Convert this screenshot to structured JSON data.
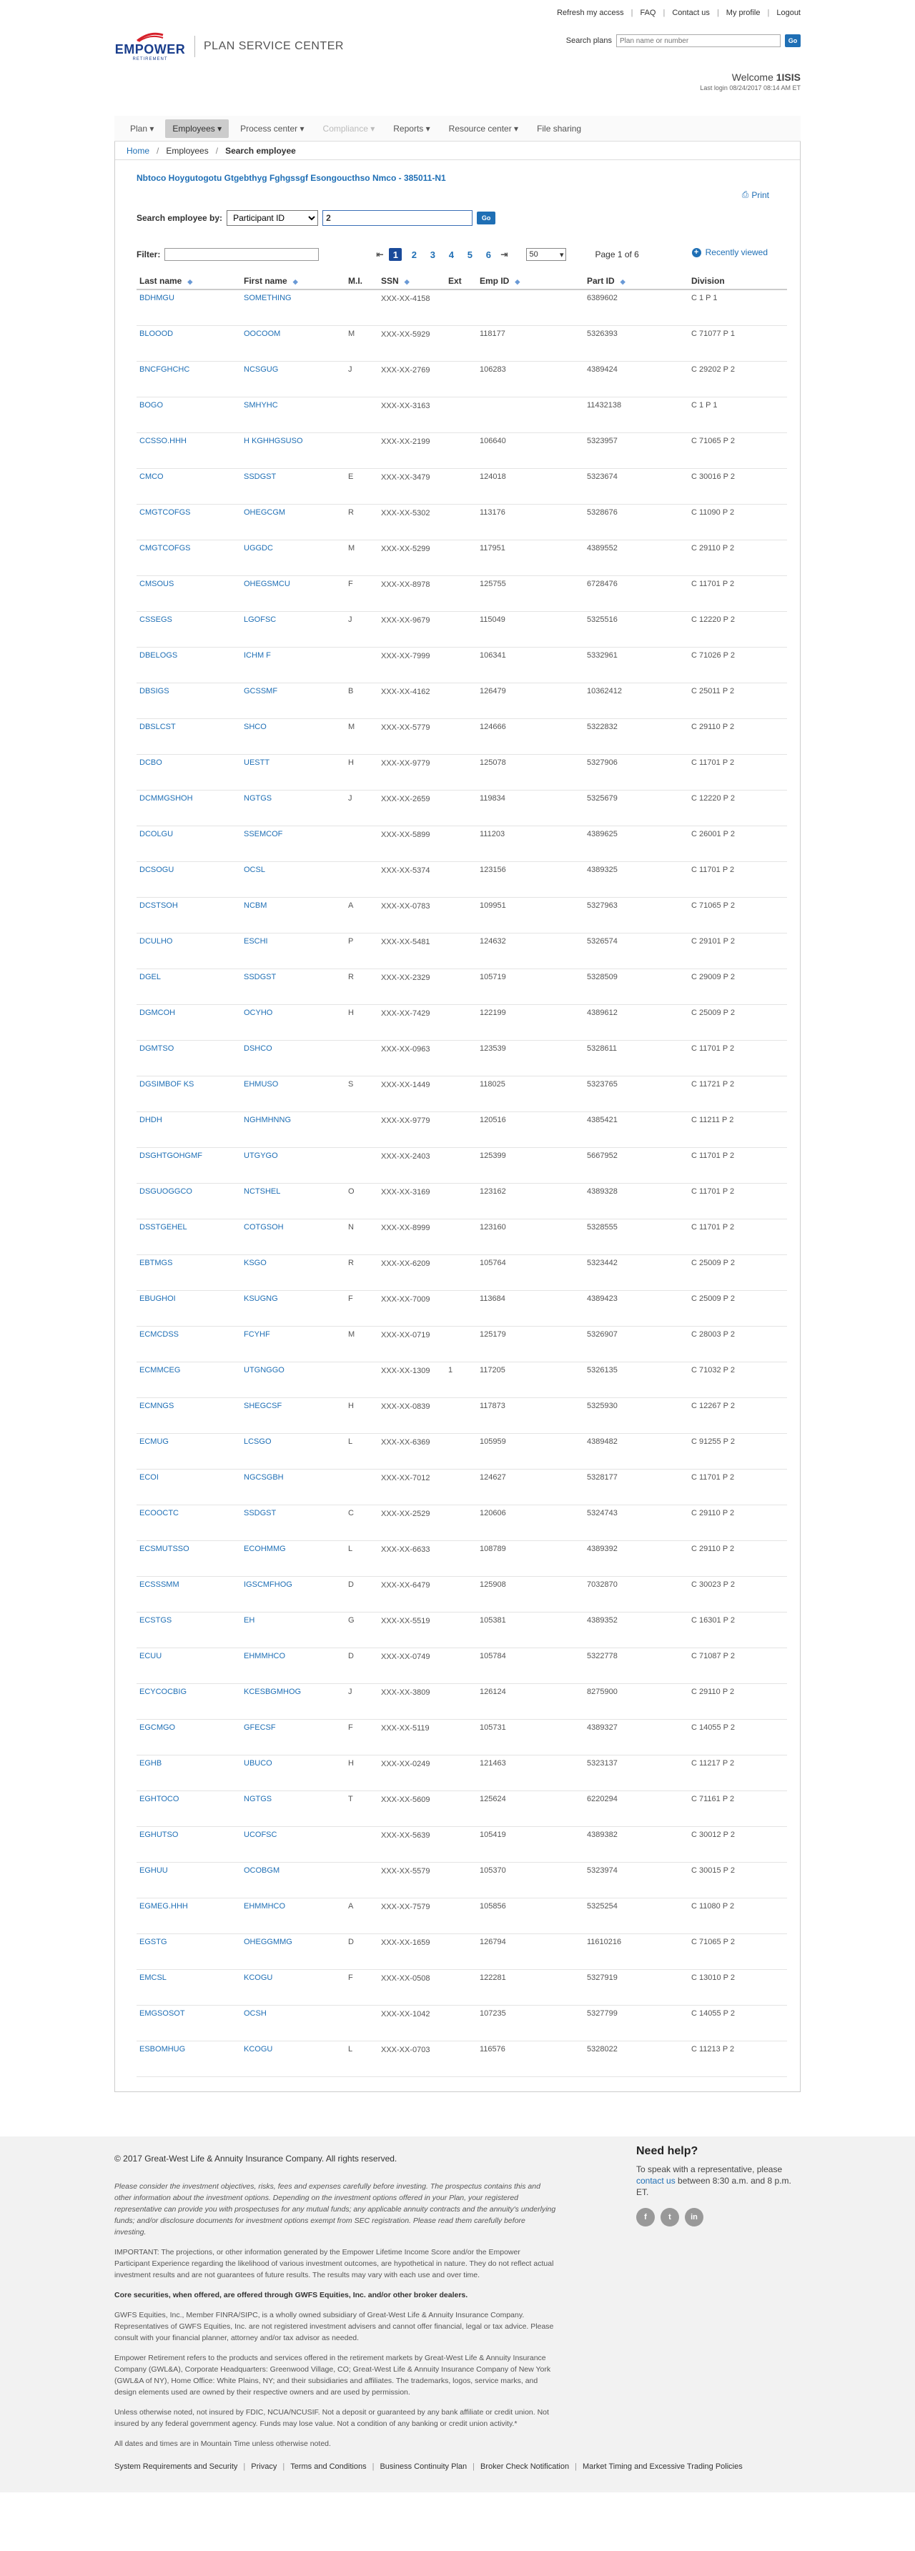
{
  "utility_links": [
    "Refresh my access",
    "FAQ",
    "Contact us",
    "My profile",
    "Logout"
  ],
  "brand": {
    "logo_text": "EMPOWER",
    "logo_sub": "RETIREMENT",
    "title": "PLAN SERVICE CENTER"
  },
  "plan_search": {
    "label": "Search plans",
    "placeholder": "Plan name or number",
    "go": "Go"
  },
  "welcome": {
    "label": "Welcome",
    "user": "1ISIS",
    "last_login": "Last login 08/24/2017 08:14 AM ET"
  },
  "nav": {
    "items": [
      "Plan",
      "Employees",
      "Process center",
      "Compliance",
      "Reports",
      "Resource center",
      "File sharing"
    ]
  },
  "breadcrumb": {
    "home": "Home",
    "employees": "Employees",
    "current": "Search employee"
  },
  "print_label": "Print",
  "plan_name": "Nbtoco Hoygutogotu Gtgebthyg Fghgssgf Esongoucthso Nmco - 385011-N1",
  "search_by": {
    "label": "Search employee by:",
    "field": "Participant ID",
    "value": "2",
    "go": "Go"
  },
  "recently_viewed": "Recently viewed",
  "filter_label": "Filter:",
  "pager": {
    "pages": [
      "1",
      "2",
      "3",
      "4",
      "5",
      "6"
    ],
    "current": "1",
    "page_size": "50",
    "page_of": "Page 1 of 6"
  },
  "table": {
    "headers": [
      "Last name",
      "First name",
      "M.I.",
      "SSN",
      "Ext",
      "Emp ID",
      "Part ID",
      "Division"
    ],
    "rows": [
      [
        "BDHMGU",
        "SOMETHING",
        "",
        "XXX-XX-4158",
        "",
        "",
        "6389602",
        "C 1 P 1"
      ],
      [
        "BLOOOD",
        "OOCOOM",
        "M",
        "XXX-XX-5929",
        "",
        "118177",
        "5326393",
        "C 71077 P 1"
      ],
      [
        "BNCFGHCHC",
        "NCSGUG",
        "J",
        "XXX-XX-2769",
        "",
        "106283",
        "4389424",
        "C 29202 P 2"
      ],
      [
        "BOGO",
        "SMHYHC",
        "",
        "XXX-XX-3163",
        "",
        "",
        "11432138",
        "C 1 P 1"
      ],
      [
        "CCSSO.HHH",
        "H KGHHGSUSO",
        "",
        "XXX-XX-2199",
        "",
        "106640",
        "5323957",
        "C 71065 P 2"
      ],
      [
        "CMCO",
        "SSDGST",
        "E",
        "XXX-XX-3479",
        "",
        "124018",
        "5323674",
        "C 30016 P 2"
      ],
      [
        "CMGTCOFGS",
        "OHEGCGM",
        "R",
        "XXX-XX-5302",
        "",
        "113176",
        "5328676",
        "C 11090 P 2"
      ],
      [
        "CMGTCOFGS",
        "UGGDC",
        "M",
        "XXX-XX-5299",
        "",
        "117951",
        "4389552",
        "C 29110 P 2"
      ],
      [
        "CMSOUS",
        "OHEGSMCU",
        "F",
        "XXX-XX-8978",
        "",
        "125755",
        "6728476",
        "C 11701 P 2"
      ],
      [
        "CSSEGS",
        "LGOFSC",
        "J",
        "XXX-XX-9679",
        "",
        "115049",
        "5325516",
        "C 12220 P 2"
      ],
      [
        "DBELOGS",
        "ICHM F",
        "",
        "XXX-XX-7999",
        "",
        "106341",
        "5332961",
        "C 71026 P 2"
      ],
      [
        "DBSIGS",
        "GCSSMF",
        "B",
        "XXX-XX-4162",
        "",
        "126479",
        "10362412",
        "C 25011 P 2"
      ],
      [
        "DBSLCST",
        "SHCO",
        "M",
        "XXX-XX-5779",
        "",
        "124666",
        "5322832",
        "C 29110 P 2"
      ],
      [
        "DCBO",
        "UESTT",
        "H",
        "XXX-XX-9779",
        "",
        "125078",
        "5327906",
        "C 11701 P 2"
      ],
      [
        "DCMMGSHOH",
        "NGTGS",
        "J",
        "XXX-XX-2659",
        "",
        "119834",
        "5325679",
        "C 12220 P 2"
      ],
      [
        "DCOLGU",
        "SSEMCOF",
        "",
        "XXX-XX-5899",
        "",
        "111203",
        "4389625",
        "C 26001 P 2"
      ],
      [
        "DCSOGU",
        "OCSL",
        "",
        "XXX-XX-5374",
        "",
        "123156",
        "4389325",
        "C 11701 P 2"
      ],
      [
        "DCSTSOH",
        "NCBM",
        "A",
        "XXX-XX-0783",
        "",
        "109951",
        "5327963",
        "C 71065 P 2"
      ],
      [
        "DCULHO",
        "ESCHI",
        "P",
        "XXX-XX-5481",
        "",
        "124632",
        "5326574",
        "C 29101 P 2"
      ],
      [
        "DGEL",
        "SSDGST",
        "R",
        "XXX-XX-2329",
        "",
        "105719",
        "5328509",
        "C 29009 P 2"
      ],
      [
        "DGMCOH",
        "OCYHO",
        "H",
        "XXX-XX-7429",
        "",
        "122199",
        "4389612",
        "C 25009 P 2"
      ],
      [
        "DGMTSO",
        "DSHCO",
        "",
        "XXX-XX-0963",
        "",
        "123539",
        "5328611",
        "C 11701 P 2"
      ],
      [
        "DGSIMBOF KS",
        "EHMUSO",
        "S",
        "XXX-XX-1449",
        "",
        "118025",
        "5323765",
        "C 11721 P 2"
      ],
      [
        "DHDH",
        "NGHMHNNG",
        "",
        "XXX-XX-9779",
        "",
        "120516",
        "4385421",
        "C 11211 P 2"
      ],
      [
        "DSGHTGOHGMF",
        "UTGYGO",
        "",
        "XXX-XX-2403",
        "",
        "125399",
        "5667952",
        "C 11701 P 2"
      ],
      [
        "DSGUOGGCO",
        "NCTSHEL",
        "O",
        "XXX-XX-3169",
        "",
        "123162",
        "4389328",
        "C 11701 P 2"
      ],
      [
        "DSSTGEHEL",
        "COTGSOH",
        "N",
        "XXX-XX-8999",
        "",
        "123160",
        "5328555",
        "C 11701 P 2"
      ],
      [
        "EBTMGS",
        "KSGO",
        "R",
        "XXX-XX-6209",
        "",
        "105764",
        "5323442",
        "C 25009 P 2"
      ],
      [
        "EBUGHOI",
        "KSUGNG",
        "F",
        "XXX-XX-7009",
        "",
        "113684",
        "4389423",
        "C 25009 P 2"
      ],
      [
        "ECMCDSS",
        "FCYHF",
        "M",
        "XXX-XX-0719",
        "",
        "125179",
        "5326907",
        "C 28003 P 2"
      ],
      [
        "ECMMCEG",
        "UTGNGGO",
        "",
        "XXX-XX-1309",
        "1",
        "117205",
        "5326135",
        "C 71032 P 2"
      ],
      [
        "ECMNGS",
        "SHEGCSF",
        "H",
        "XXX-XX-0839",
        "",
        "117873",
        "5325930",
        "C 12267 P 2"
      ],
      [
        "ECMUG",
        "LCSGO",
        "L",
        "XXX-XX-6369",
        "",
        "105959",
        "4389482",
        "C 91255 P 2"
      ],
      [
        "ECOI",
        "NGCSGBH",
        "",
        "XXX-XX-7012",
        "",
        "124627",
        "5328177",
        "C 11701 P 2"
      ],
      [
        "ECOOCTC",
        "SSDGST",
        "C",
        "XXX-XX-2529",
        "",
        "120606",
        "5324743",
        "C 29110 P 2"
      ],
      [
        "ECSMUTSSO",
        "ECOHMMG",
        "L",
        "XXX-XX-6633",
        "",
        "108789",
        "4389392",
        "C 29110 P 2"
      ],
      [
        "ECSSSMM",
        "IGSCMFHOG",
        "D",
        "XXX-XX-6479",
        "",
        "125908",
        "7032870",
        "C 30023 P 2"
      ],
      [
        "ECSTGS",
        "EH",
        "G",
        "XXX-XX-5519",
        "",
        "105381",
        "4389352",
        "C 16301 P 2"
      ],
      [
        "ECUU",
        "EHMMHCO",
        "D",
        "XXX-XX-0749",
        "",
        "105784",
        "5322778",
        "C 71087 P 2"
      ],
      [
        "ECYCOCBIG",
        "KCESBGMHOG",
        "J",
        "XXX-XX-3809",
        "",
        "126124",
        "8275900",
        "C 29110 P 2"
      ],
      [
        "EGCMGO",
        "GFECSF",
        "F",
        "XXX-XX-5119",
        "",
        "105731",
        "4389327",
        "C 14055 P 2"
      ],
      [
        "EGHB",
        "UBUCO",
        "H",
        "XXX-XX-0249",
        "",
        "121463",
        "5323137",
        "C 11217 P 2"
      ],
      [
        "EGHTOCO",
        "NGTGS",
        "T",
        "XXX-XX-5609",
        "",
        "125624",
        "6220294",
        "C 71161 P 2"
      ],
      [
        "EGHUTSO",
        "UCOFSC",
        "",
        "XXX-XX-5639",
        "",
        "105419",
        "4389382",
        "C 30012 P 2"
      ],
      [
        "EGHUU",
        "OCOBGM",
        "",
        "XXX-XX-5579",
        "",
        "105370",
        "5323974",
        "C 30015 P 2"
      ],
      [
        "EGMEG.HHH",
        "EHMMHCO",
        "A",
        "XXX-XX-7579",
        "",
        "105856",
        "5325254",
        "C 11080 P 2"
      ],
      [
        "EGSTG",
        "OHEGGMMG",
        "D",
        "XXX-XX-1659",
        "",
        "126794",
        "11610216",
        "C 71065 P 2"
      ],
      [
        "EMCSL",
        "KCOGU",
        "F",
        "XXX-XX-0508",
        "",
        "122281",
        "5327919",
        "C 13010 P 2"
      ],
      [
        "EMGSOSOT",
        "OCSH",
        "",
        "XXX-XX-1042",
        "",
        "107235",
        "5327799",
        "C 14055 P 2"
      ],
      [
        "ESBOMHUG",
        "KCOGU",
        "L",
        "XXX-XX-0703",
        "",
        "116576",
        "5328022",
        "C 11213 P 2"
      ]
    ]
  },
  "footer": {
    "copyright": "© 2017 Great-West Life & Annuity Insurance Company. All rights reserved.",
    "need_help_title": "Need help?",
    "need_help_text": "To speak with a representative, please",
    "contact_us": "contact us",
    "hours": "between 8:30 a.m. and 8 p.m. ET.",
    "social": [
      "f",
      "t",
      "in"
    ],
    "disc1": "Please consider the investment objectives, risks, fees and expenses carefully before investing. The prospectus contains this and other information about the investment options. Depending on the investment options offered in your Plan, your registered representative can provide you with prospectuses for any mutual funds; any applicable annuity contracts and the annuity's underlying funds; and/or disclosure documents for investment options exempt from SEC registration. Please read them carefully before investing.",
    "disc2": "IMPORTANT: The projections, or other information generated by the Empower Lifetime Income Score and/or the Empower Participant Experience regarding the likelihood of various investment outcomes, are hypothetical in nature. They do not reflect actual investment results and are not guarantees of future results. The results may vary with each use and over time.",
    "disc3": "Core securities, when offered, are offered through GWFS Equities, Inc. and/or other broker dealers.",
    "disc4": "GWFS Equities, Inc., Member FINRA/SIPC, is a wholly owned subsidiary of Great-West Life & Annuity Insurance Company. Representatives of GWFS Equities, Inc. are not registered investment advisers and cannot offer financial, legal or tax advice. Please consult with your financial planner, attorney and/or tax advisor as needed.",
    "disc5": "Empower Retirement refers to the products and services offered in the retirement markets by Great-West Life & Annuity Insurance Company (GWL&A), Corporate Headquarters: Greenwood Village, CO; Great-West Life & Annuity Insurance Company of New York (GWL&A of NY), Home Office: White Plains, NY; and their subsidiaries and affiliates. The trademarks, logos, service marks, and design elements used are owned by their respective owners and are used by permission.",
    "disc6": "Unless otherwise noted, not insured by FDIC, NCUA/NCUSIF. Not a deposit or guaranteed by any bank affiliate or credit union. Not insured by any federal government agency. Funds may lose value. Not a condition of any banking or credit union activity.*",
    "disc7": "All dates and times are in Mountain Time unless otherwise noted.",
    "links": [
      "System Requirements and Security",
      "Privacy",
      "Terms and Conditions",
      "Business Continuity Plan",
      "Broker Check Notification",
      "Market Timing and Excessive Trading Policies"
    ]
  }
}
